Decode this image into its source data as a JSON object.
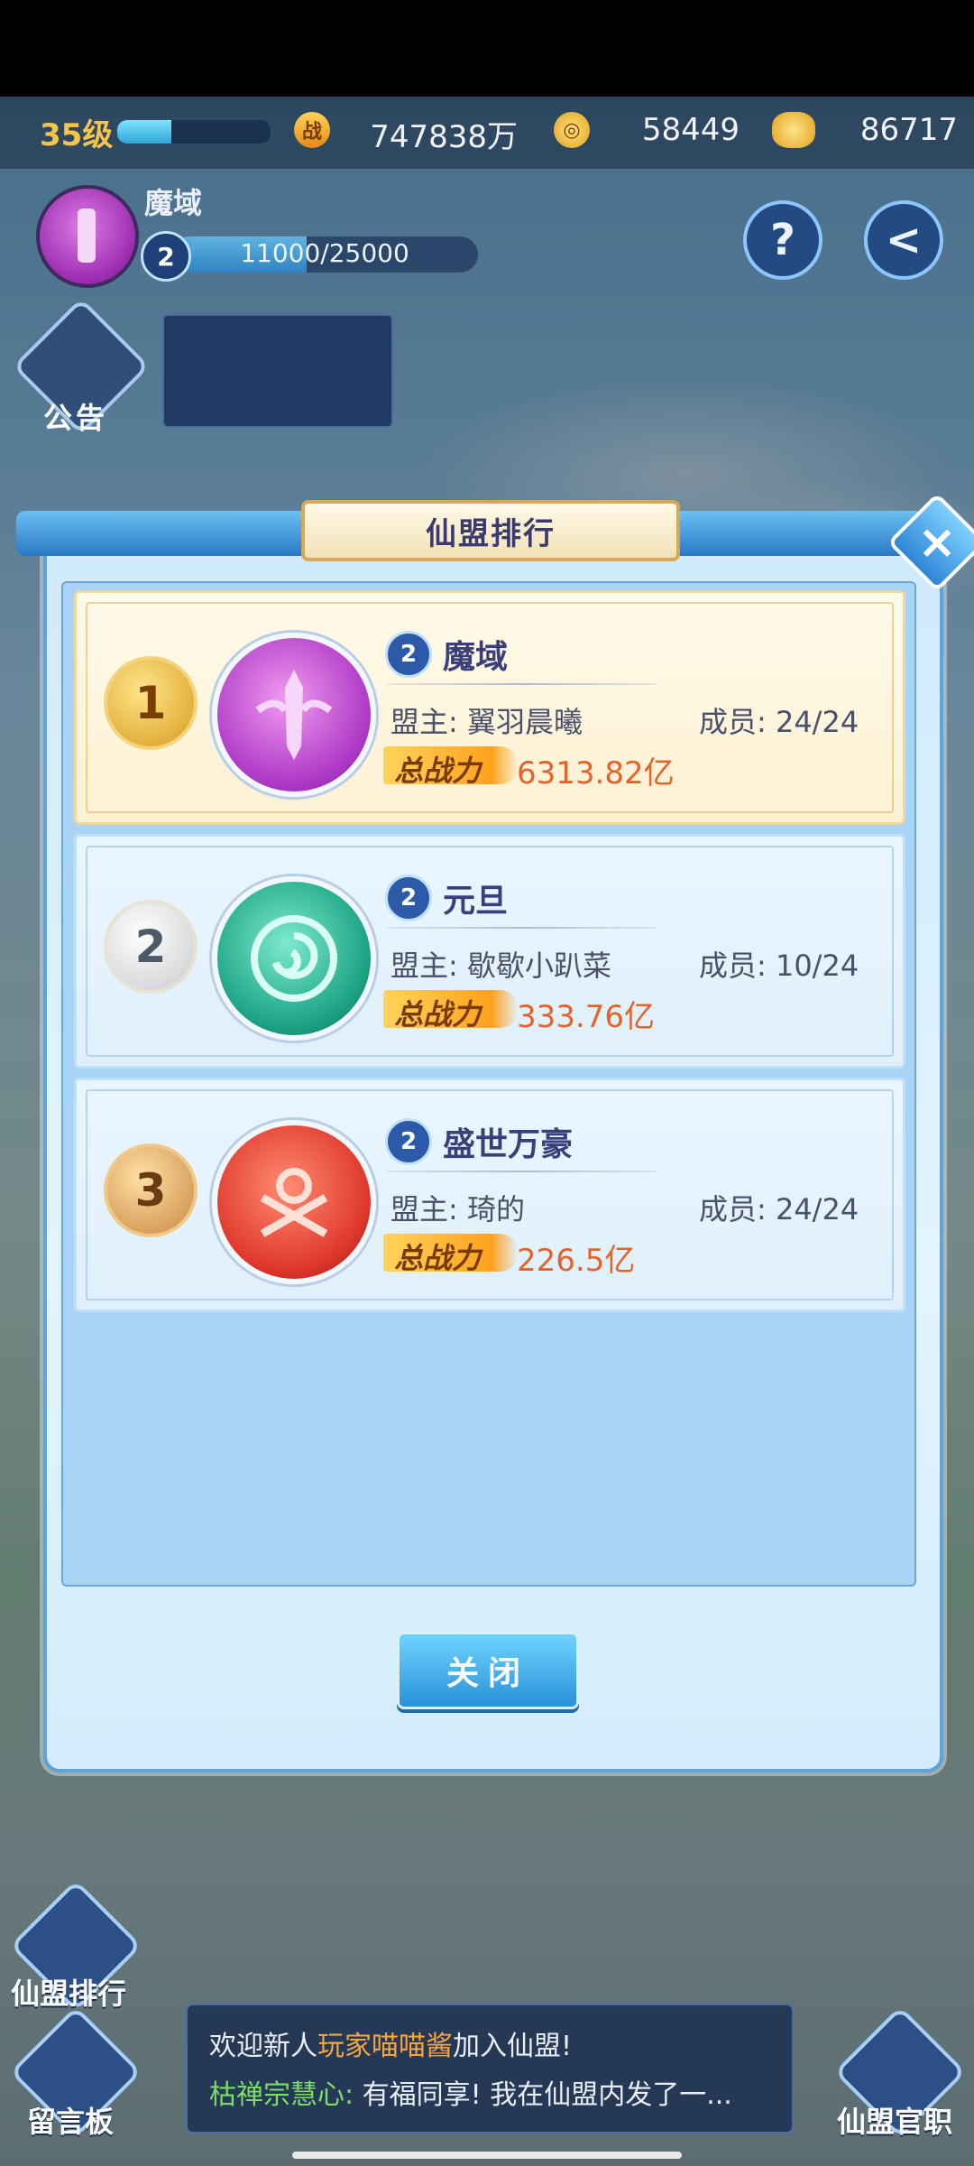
{
  "status": {
    "level": "35级",
    "xp_fraction": 0.35,
    "power_icon": "战",
    "power_value": "747838万",
    "coin_value": "58449",
    "ingot_value": "86717"
  },
  "alliance": {
    "name": "魔域",
    "level": "2",
    "progress_text": "11000/25000",
    "progress_fraction": 0.44,
    "help_icon": "?",
    "back_icon": "<",
    "announce_label": "公告"
  },
  "modal": {
    "title": "仙盟排行",
    "close_glyph": "×",
    "close_button": "关闭",
    "power_label": "总战力",
    "rows": [
      {
        "rank": "1",
        "level": "2",
        "name": "魔域",
        "leader": "盟主: 翼羽晨曦",
        "members": "成员: 24/24",
        "power": "6313.82亿",
        "emblem": "sword-emblem-icon"
      },
      {
        "rank": "2",
        "level": "2",
        "name": "元旦",
        "leader": "盟主: 歇歇小趴菜",
        "members": "成员: 10/24",
        "power": "333.76亿",
        "emblem": "lotus-emblem-icon"
      },
      {
        "rank": "3",
        "level": "2",
        "name": "盛世万豪",
        "leader": "盟主: 琦的",
        "members": "成员: 24/24",
        "power": "226.5亿",
        "emblem": "crossed-swords-emblem-icon"
      }
    ]
  },
  "bottom": {
    "rank_label": "仙盟排行",
    "board_label": "留言板",
    "office_label": "仙盟官职",
    "chat_line1_prefix": "欢迎新人",
    "chat_line1_player": "玩家喵喵酱",
    "chat_line1_suffix": "加入仙盟!",
    "chat_line2_name": "枯禅宗慧心:",
    "chat_line2_text": "有福同享! 我在仙盟内发了一..."
  },
  "colors": {
    "accent_gold": "#f5c44a",
    "power_orange": "#e5622a",
    "panel_blue": "#aad4f6"
  }
}
